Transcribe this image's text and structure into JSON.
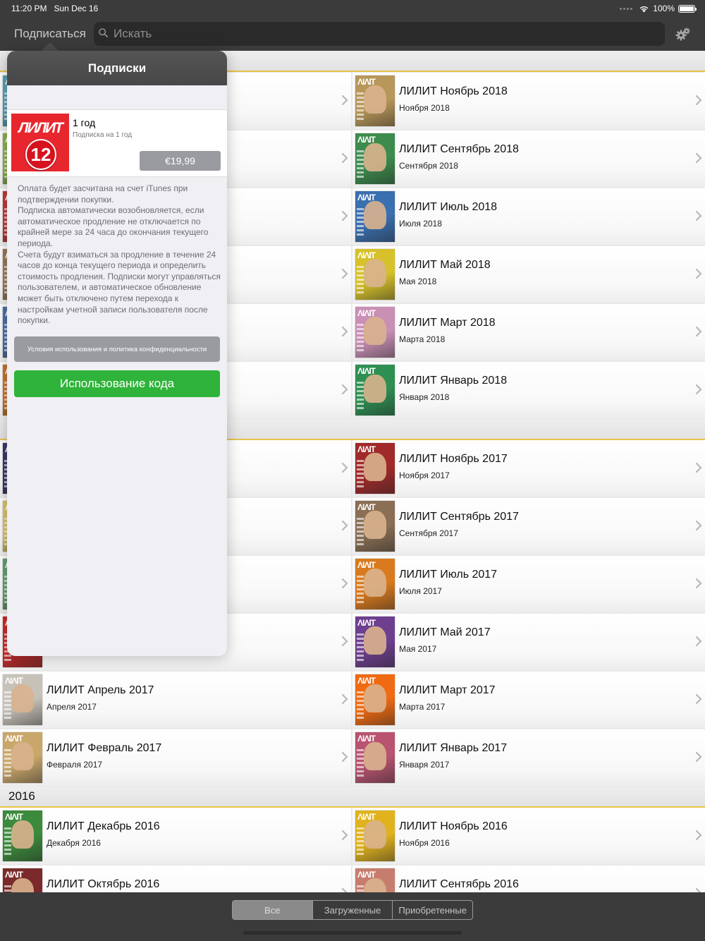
{
  "status": {
    "time": "11:20 PM",
    "date": "Sun Dec 16",
    "battery": "100%",
    "battery_level": 1.0
  },
  "nav": {
    "subscribe_label": "Подписаться",
    "search_placeholder": "Искать"
  },
  "popover": {
    "title": "Подписки",
    "product": {
      "name": "1 год",
      "description": "Подписка на 1 год",
      "price": "€19,99",
      "logo_text": "ЛИЛИТ",
      "logo_number": "12"
    },
    "terms": "Оплата будет засчитана на счет iTunes при подтверждении покупки.\nПодписка автоматически возобновляется, если автоматическое продление не отключается по крайней мере за 24 часа до окончания текущего периода.\nСчета будут взиматься за продление в течение 24 часов до конца текущего периода и определить стоимость продления. Подписки могут управляться пользователем, и автоматическое обновление может быть отключено путем перехода к настройкам учетной записи пользователя после покупки.",
    "terms_button": "Условия использования и политика конфиденциальности",
    "code_button": "Использование кода"
  },
  "sections": [
    {
      "title": ""
    },
    {
      "title": ""
    },
    {
      "title": "2016"
    }
  ],
  "issues": [
    {
      "title": "ЛИЛИТ Ноябрь 2018",
      "subtitle": "Ноября 2018",
      "cover_color": "#b8975a"
    },
    {
      "title": "ЛИЛИТ Сентябрь 2018",
      "subtitle": "Сентября 2018",
      "cover_color": "#3d8c4e"
    },
    {
      "title": "ЛИЛИТ Июль 2018",
      "subtitle": "Июля 2018",
      "cover_color": "#3a6fb0"
    },
    {
      "title": "ЛИЛИТ Май 2018",
      "subtitle": "Мая 2018",
      "cover_color": "#d6c12a"
    },
    {
      "title": "ЛИЛИТ Март 2018",
      "subtitle": "Марта 2018",
      "cover_color": "#c98fb5"
    },
    {
      "title": "ЛИЛИТ Январь 2018",
      "subtitle": "Января 2018",
      "cover_color": "#2e8f52"
    },
    {
      "title": "ЛИЛИТ Ноябрь 2017",
      "subtitle": "Ноября 2017",
      "cover_color": "#a02a2a"
    },
    {
      "title": "ЛИЛИТ  Сентябрь 2017",
      "subtitle": "Сентября 2017",
      "cover_color": "#8a6f55"
    },
    {
      "title": "ЛИЛИТ Июль 2017",
      "subtitle": "Июля 2017",
      "cover_color": "#d97a1e"
    },
    {
      "title": "ЛИЛИТ Май 2017",
      "subtitle": "Мая 2017",
      "cover_color": "#6e3f8f"
    },
    {
      "title": "ЛИЛИТ Апрель 2017",
      "subtitle": "Апреля 2017",
      "cover_color": "#c7c2b8"
    },
    {
      "title": "ЛИЛИТ Март 2017",
      "subtitle": "Марта 2017",
      "cover_color": "#f06a13"
    },
    {
      "title": "ЛИЛИТ Февраль 2017",
      "subtitle": "Февраля 2017",
      "cover_color": "#c9a76b"
    },
    {
      "title": "ЛИЛИТ Январь 2017",
      "subtitle": "Января 2017",
      "cover_color": "#b85470"
    },
    {
      "title": "ЛИЛИТ Декабрь 2016",
      "subtitle": "Декабря 2016",
      "cover_color": "#3c8a3c"
    },
    {
      "title": "ЛИЛИТ Ноябрь 2016",
      "subtitle": "Ноября 2016",
      "cover_color": "#e0b21e"
    },
    {
      "title": "ЛИЛИТ Октябрь 2016",
      "subtitle": "",
      "cover_color": "#7a2a2a"
    },
    {
      "title": "ЛИЛИТ Сентябрь 2016",
      "subtitle": "",
      "cover_color": "#c77d6e"
    }
  ],
  "hidden_covers": [
    {
      "cover_color": "#58a0b8"
    },
    {
      "cover_color": "#8bb04c"
    },
    {
      "cover_color": "#c03a3a"
    },
    {
      "cover_color": "#9a7a5a"
    },
    {
      "cover_color": "#4c6fa8"
    },
    {
      "cover_color": "#c8732c"
    },
    {
      "cover_color": "#3a3a6a"
    },
    {
      "cover_color": "#d8c46a"
    },
    {
      "cover_color": "#68a070"
    },
    {
      "cover_color": "#cc2b2b"
    }
  ],
  "filter": {
    "tabs": [
      "Все",
      "Загруженные",
      "Приобретенные"
    ],
    "selected": "Все"
  }
}
